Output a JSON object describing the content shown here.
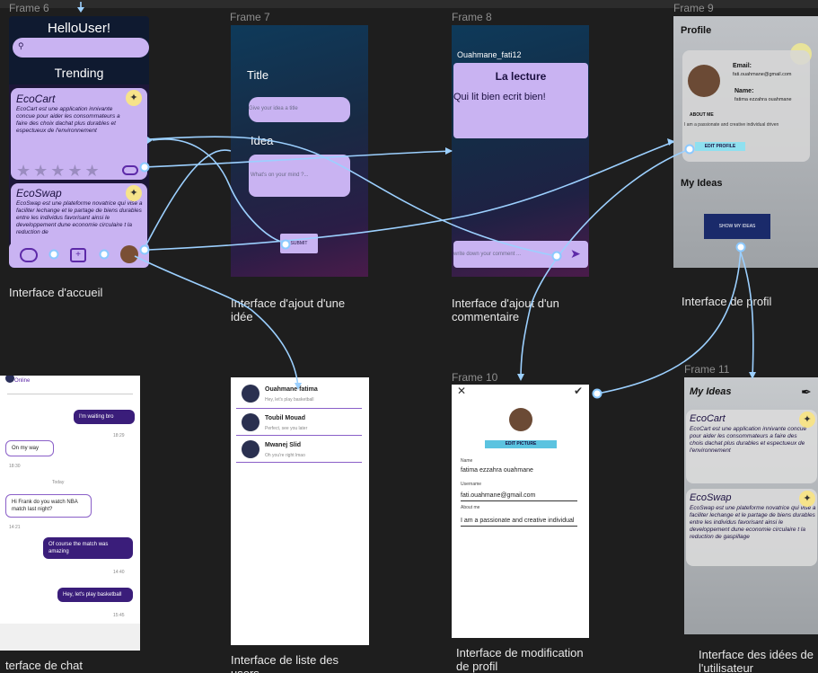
{
  "colors": {
    "canvas": "#1e1e1e",
    "lavender": "#c9b3f2",
    "purple": "#3a1d7a",
    "accent": "#5bc3e0"
  },
  "frames": {
    "f6": {
      "title": "Frame 6"
    },
    "f7": {
      "title": "Frame 7"
    },
    "f8": {
      "title": "Frame 8"
    },
    "f9": {
      "title": "Frame 9"
    },
    "f10": {
      "title": "Frame 10"
    },
    "f11": {
      "title": "Frame 11"
    }
  },
  "home": {
    "greeting": "HelloUser!",
    "search_icon": "search-icon",
    "trending": "Trending",
    "cards": [
      {
        "title": "EcoCart",
        "desc": "EcoCart est une application innivante concue pour aider les consommateurs a faire des choix dachat plus durables et espectueux de l'environnement",
        "stars": "★★★★★"
      },
      {
        "title": "EcoSwap",
        "desc": "EcoSwap est une plateforme novatrice qui vise a faciliter lechange et le partage de biens durables entre les individus favorisant ainsi le developpement dune economie circulaire t la reduction de"
      }
    ],
    "caption": "Interface d'accueil"
  },
  "idea": {
    "title_label": "Title",
    "title_placeholder": "Give your idea a title",
    "idea_label": "Idea",
    "idea_placeholder": "What's on your mind ?...",
    "submit": "SUBMIT",
    "caption": "Interface d'ajout d'une idée"
  },
  "comment": {
    "user": "Ouahmane_fati12",
    "card_title": "La lecture",
    "card_text": "Qui lit bien ecrit bien!",
    "input_placeholder": "write down your comment ...",
    "caption": "Interface d'ajout d'un commentaire"
  },
  "profile": {
    "header": "Profile",
    "email_label": "Email:",
    "email": "fati.ouahmane@gmail.com",
    "name_label": "Name:",
    "name": "fatima ezzahra ouahmane",
    "about_label": "ABOUT ME",
    "about": "I am a passionate and creative individual driven",
    "edit": "EDIT PROFILE",
    "my_ideas": "My Ideas",
    "show": "SHOW MY IDEAS",
    "caption": "Interface de profil"
  },
  "chat": {
    "status": "Online",
    "messages": [
      "I'm waiting bro",
      "On my way",
      "Hi Frank do you watch NBA match last night?",
      "Of course the match was amazing",
      "Hey, let's play basketball"
    ],
    "times": [
      "18:29",
      "18:30",
      "14:21",
      "14:40",
      "15:45"
    ],
    "today": "Today",
    "caption": "terface de chat"
  },
  "users": {
    "list": [
      {
        "name": "Ouahmane fatima",
        "msg": "Hey, let's play basketball"
      },
      {
        "name": "Toubil Mouad",
        "msg": "Perfect, see you later"
      },
      {
        "name": "Mwanej Slid",
        "msg": "Oh you're right lmao"
      }
    ],
    "caption": "Interface de liste des users"
  },
  "edit": {
    "picture": "EDIT PICTURE",
    "name_label": "Name",
    "name": "fatima ezzahra ouahmane",
    "user_label": "Username",
    "user": "fati.ouahmane@gmail.com",
    "about_label": "About me",
    "about": "I am a passionate and creative individual",
    "caption": "Interface de modification de profil"
  },
  "ideas": {
    "header": "My Ideas",
    "cards": [
      {
        "title": "EcoCart",
        "desc": "EcoCart est une application innivante concue pour aider les consommateurs a faire des chois dachat plus durables et espectueux de l'environnement"
      },
      {
        "title": "EcoSwap",
        "desc": "EcoSwap est une plateforme novatrice qui vise a faciliter lechange et le partage de biens durables entre les individus favorisant ainsi le developpement dune economie circulaire t la reduction de gaspillage"
      }
    ],
    "caption": "Interface des idées de l'utilisateur"
  }
}
